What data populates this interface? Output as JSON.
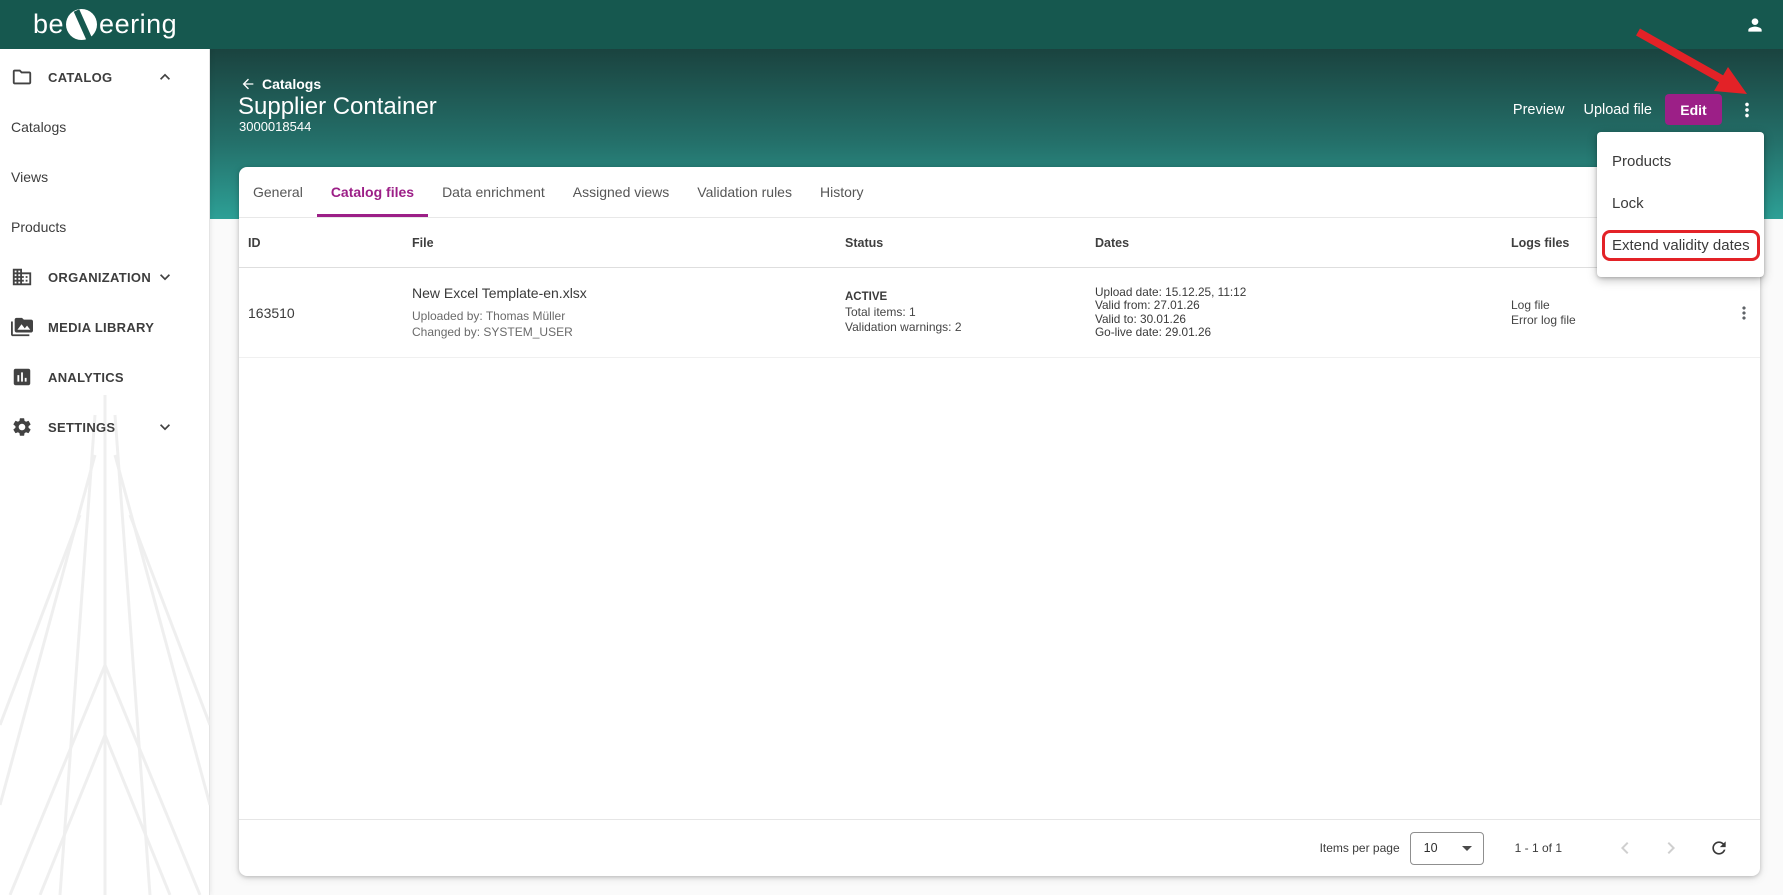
{
  "topbar": {
    "logo_pre": "be",
    "logo_post": "eering"
  },
  "sidebar": {
    "catalog": {
      "label": "CATALOG"
    },
    "catalog_items": [
      {
        "label": "Catalogs"
      },
      {
        "label": "Views"
      },
      {
        "label": "Products"
      }
    ],
    "organization": {
      "label": "ORGANIZATION"
    },
    "media_library": {
      "label": "MEDIA LIBRARY"
    },
    "analytics": {
      "label": "ANALYTICS"
    },
    "settings": {
      "label": "SETTINGS"
    }
  },
  "header": {
    "breadcrumb": "Catalogs",
    "title": "Supplier Container",
    "subtitle": "3000018544",
    "actions": {
      "preview": "Preview",
      "upload": "Upload file",
      "edit": "Edit"
    }
  },
  "context_menu": {
    "items": [
      {
        "label": "Products"
      },
      {
        "label": "Lock"
      },
      {
        "label": "Extend validity dates",
        "highlighted": true
      }
    ]
  },
  "tabs": [
    {
      "label": "General",
      "active": false
    },
    {
      "label": "Catalog files",
      "active": true
    },
    {
      "label": "Data enrichment",
      "active": false
    },
    {
      "label": "Assigned views",
      "active": false
    },
    {
      "label": "Validation rules",
      "active": false
    },
    {
      "label": "History",
      "active": false
    }
  ],
  "table": {
    "columns": {
      "id": "ID",
      "file": "File",
      "status": "Status",
      "dates": "Dates",
      "logs": "Logs files"
    },
    "row": {
      "id": "163510",
      "file_name": "New Excel Template-en.xlsx",
      "uploaded_by": "Uploaded by: Thomas Müller",
      "changed_by": "Changed by: SYSTEM_USER",
      "status_state": "ACTIVE",
      "status_total": "Total items: 1",
      "status_warnings": "Validation warnings: 2",
      "date_upload": "Upload date: 15.12.25, 11:12",
      "date_valid_from": "Valid from: 27.01.26",
      "date_valid_to": "Valid to: 30.01.26",
      "date_golive": "Go-live date: 29.01.26",
      "log_file": "Log file",
      "error_log_file": "Error log file"
    }
  },
  "paginator": {
    "items_per_page_label": "Items per page",
    "page_size": "10",
    "range_label": "1 - 1 of 1"
  },
  "colors": {
    "topbar_teal": "#16584f",
    "hero_teal_dark": "#1a433f",
    "hero_teal_light": "#2da096",
    "accent_magenta": "#9c1f87",
    "annotation_red": "#e32227"
  }
}
